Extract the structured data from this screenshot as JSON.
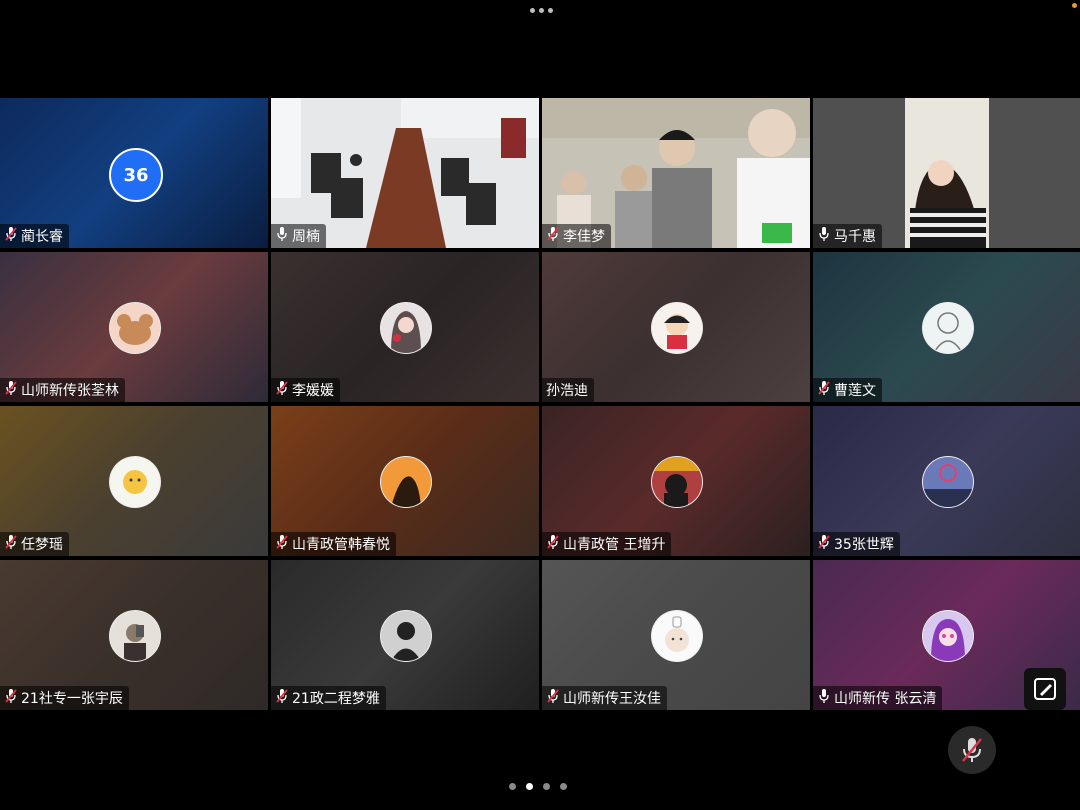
{
  "participants": [
    {
      "name": "蔺长睿",
      "muted": true,
      "avatar_text": "36",
      "bg": "linear-gradient(135deg,#0d2a5c,#123f80 50%,#0a1d40)"
    },
    {
      "name": "周楠",
      "muted": false,
      "video": "meeting-room",
      "bg": "#d8dde0"
    },
    {
      "name": "李佳梦",
      "muted": true,
      "video": "group",
      "bg": "#c9c4b8"
    },
    {
      "name": "马千惠",
      "muted": false,
      "video": "speaker",
      "active": true,
      "bg": "#555"
    },
    {
      "name": "山师新传张荃林",
      "muted": true,
      "avatar": "mouse-avatar",
      "bg": "linear-gradient(135deg,#3a3040,#6a3c3e 50%,#2e2a38)"
    },
    {
      "name": "李媛媛",
      "muted": true,
      "avatar": "girl-avatar",
      "bg": "linear-gradient(135deg,#3a3030,#2a2424 50%,#3b3030)"
    },
    {
      "name": "孙浩迪",
      "muted": false,
      "avatar": "cartoon-avatar",
      "bg": "linear-gradient(135deg,#503a3a,#3c3030 50%,#4c4040)"
    },
    {
      "name": "曹莲文",
      "muted": true,
      "avatar": "sketch-avatar",
      "bg": "linear-gradient(135deg,#1e3440,#2b4a4f 50%,#3a3a48)"
    },
    {
      "name": "任梦瑶",
      "muted": true,
      "avatar": "egg-avatar",
      "bg": "linear-gradient(135deg,#6a5120,#4a4030 50%,#3a3a3a)"
    },
    {
      "name": "山青政管韩春悦",
      "muted": true,
      "avatar": "orange-avatar",
      "bg": "linear-gradient(135deg,#7a3f18,#5a2c18 50%,#3a2a22)"
    },
    {
      "name": "山青政管 王增升",
      "muted": true,
      "avatar": "dark-avatar",
      "bg": "linear-gradient(135deg,#3a2424,#5a2a2a 50%,#2c2020)"
    },
    {
      "name": "35张世辉",
      "muted": true,
      "avatar": "sky-avatar",
      "bg": "linear-gradient(135deg,#2a2a48,#3a3a58 50%,#2e3040)"
    },
    {
      "name": "21社专一张宇辰",
      "muted": true,
      "avatar": "mirror-avatar",
      "bg": "linear-gradient(135deg,#4a3a30,#3a302a 50%,#2e2a28)"
    },
    {
      "name": "21政二程梦雅",
      "muted": true,
      "avatar": "bw-avatar",
      "bg": "linear-gradient(135deg,#2a2a2a,#3a3a3a 50%,#1f1f1f)"
    },
    {
      "name": "山师新传王汝佳",
      "muted": true,
      "avatar": "baby-avatar",
      "bg": "linear-gradient(135deg,#555,#4a4a4a 50%,#444)"
    },
    {
      "name": "山师新传 张云清",
      "muted": false,
      "avatar": "anime-avatar",
      "bg": "linear-gradient(135deg,#4a2a50,#6a2a5a 50%,#3a2a48)"
    }
  ],
  "pager": {
    "count": 4,
    "current": 1
  },
  "colors": {
    "active_border": "#36c24a",
    "muted_icon": "#e0334a"
  }
}
